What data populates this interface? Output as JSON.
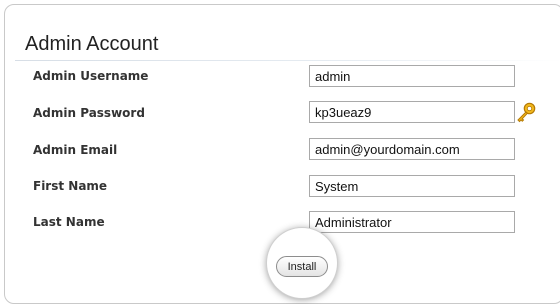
{
  "section": {
    "title": "Admin Account"
  },
  "form": {
    "fields": [
      {
        "label": "Admin Username",
        "value": "admin"
      },
      {
        "label": "Admin Password",
        "value": "kp3ueaz9"
      },
      {
        "label": "Admin Email",
        "value": "admin@yourdomain.com"
      },
      {
        "label": "First Name",
        "value": "System"
      },
      {
        "label": "Last Name",
        "value": "Administrator"
      }
    ],
    "install_label": "Install"
  },
  "icons": {
    "password_generate": "key-icon"
  },
  "colors": {
    "key_icon": "#e0a10a",
    "heading": "#222222",
    "label": "#333333"
  }
}
